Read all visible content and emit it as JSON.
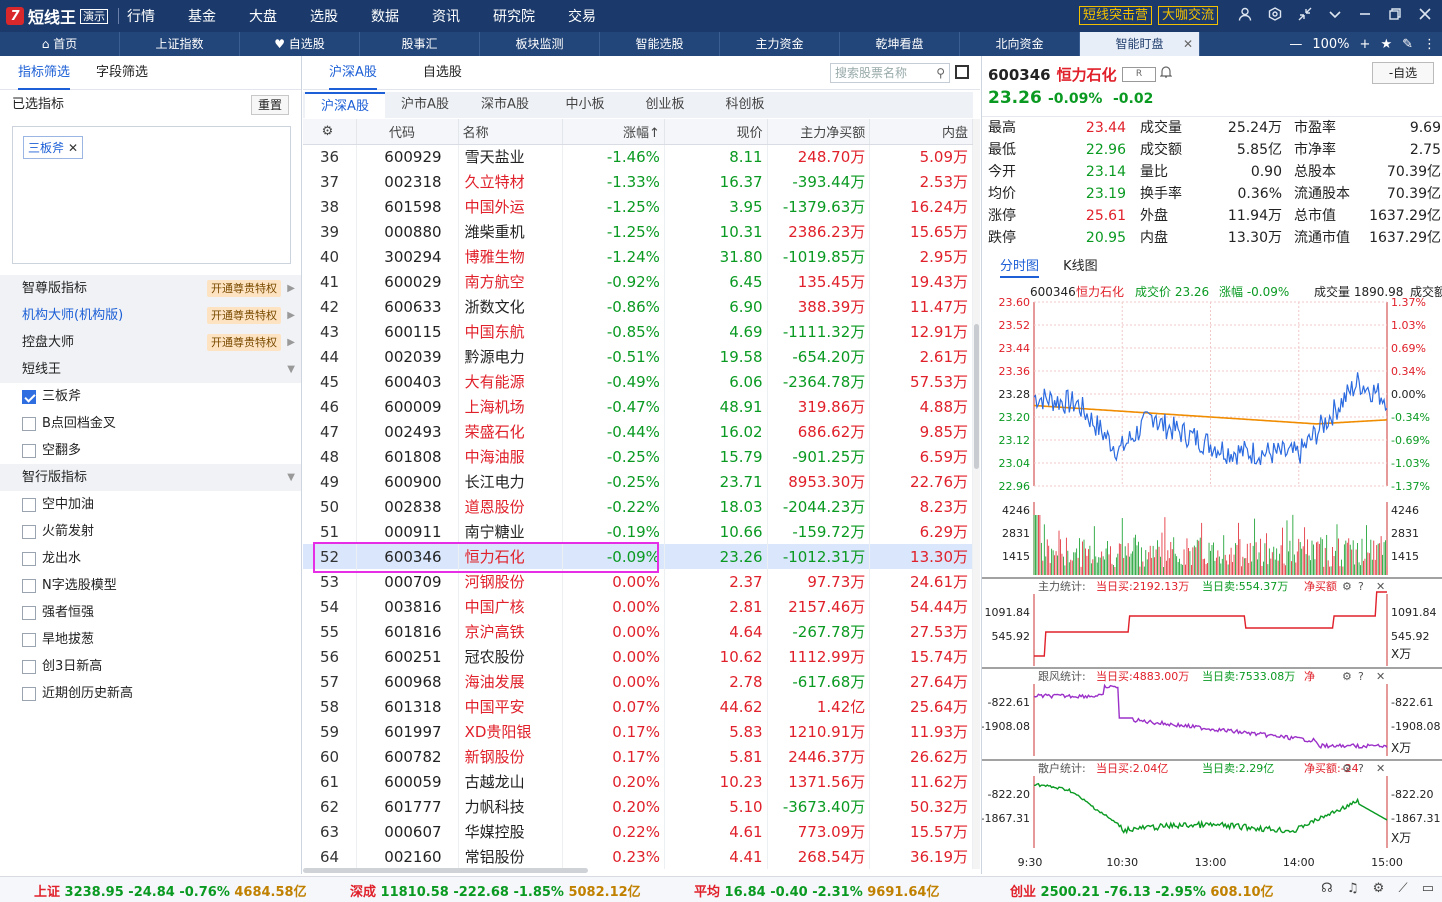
{
  "app": {
    "logo_mark": "7",
    "name": "短线王",
    "demo": "演示"
  },
  "top_menu": [
    "行情",
    "基金",
    "大盘",
    "选股",
    "数据",
    "资讯",
    "研究院",
    "交易"
  ],
  "top_buttons": [
    "短线突击营",
    "大咖交流"
  ],
  "nav_tabs": [
    {
      "label": "⌂ 首页"
    },
    {
      "label": "上证指数"
    },
    {
      "label": "♥ 自选股"
    },
    {
      "label": "股事汇"
    },
    {
      "label": "板块监测"
    },
    {
      "label": "智能选股"
    },
    {
      "label": "主力资金"
    },
    {
      "label": "乾坤看盘"
    },
    {
      "label": "北向资金"
    },
    {
      "label": "智能盯盘"
    }
  ],
  "zoom": "100%",
  "left": {
    "tabs": [
      "指标筛选",
      "字段筛选"
    ],
    "selected_title": "已选指标",
    "reset": "重置",
    "chip": "三板斧",
    "groups": [
      {
        "label": "智尊版指标",
        "badge": "开通尊贵特权"
      },
      {
        "label": "机构大师(机构版)",
        "badge": "开通尊贵特权"
      },
      {
        "label": "控盘大师",
        "badge": "开通尊贵特权"
      },
      {
        "label": "短线王"
      },
      {
        "label": "智行版指标"
      }
    ],
    "short_items": [
      "三板斧",
      "B点回档金叉",
      "空翻多"
    ],
    "smart_items": [
      "空中加油",
      "火箭发射",
      "龙出水",
      "N字选股模型",
      "强者恒强",
      "旱地拔葱",
      "创3日新高",
      "近期创历史新高"
    ]
  },
  "mid": {
    "tabs": [
      "沪深A股",
      "自选股"
    ],
    "search_placeholder": "搜索股票名称",
    "subtabs": [
      "沪深A股",
      "沪市A股",
      "深市A股",
      "中小板",
      "创业板",
      "科创板"
    ],
    "columns": [
      "代码",
      "名称",
      "涨幅↑",
      "现价",
      "主力净买额",
      "内盘"
    ],
    "rows": [
      [
        "36",
        "600929",
        "雪天盐业",
        "-1.46%",
        "8.11",
        "248.70万",
        "5.09万"
      ],
      [
        "37",
        "002318",
        "久立特材",
        "-1.33%",
        "16.37",
        "-393.44万",
        "2.53万"
      ],
      [
        "38",
        "601598",
        "中国外运",
        "-1.25%",
        "3.95",
        "-1379.63万",
        "16.24万"
      ],
      [
        "39",
        "000880",
        "潍柴重机",
        "-1.25%",
        "10.31",
        "2386.23万",
        "15.65万"
      ],
      [
        "40",
        "300294",
        "博雅生物",
        "-1.24%",
        "31.80",
        "-1019.85万",
        "2.95万"
      ],
      [
        "41",
        "600029",
        "南方航空",
        "-0.92%",
        "6.45",
        "135.45万",
        "19.43万"
      ],
      [
        "42",
        "600633",
        "浙数文化",
        "-0.86%",
        "6.90",
        "388.39万",
        "11.47万"
      ],
      [
        "43",
        "600115",
        "中国东航",
        "-0.85%",
        "4.69",
        "-1111.32万",
        "12.91万"
      ],
      [
        "44",
        "002039",
        "黔源电力",
        "-0.51%",
        "19.58",
        "-654.20万",
        "2.61万"
      ],
      [
        "45",
        "600403",
        "大有能源",
        "-0.49%",
        "6.06",
        "-2364.78万",
        "57.53万"
      ],
      [
        "46",
        "600009",
        "上海机场",
        "-0.47%",
        "48.91",
        "319.86万",
        "4.88万"
      ],
      [
        "47",
        "002493",
        "荣盛石化",
        "-0.44%",
        "16.02",
        "686.62万",
        "9.85万"
      ],
      [
        "48",
        "601808",
        "中海油服",
        "-0.25%",
        "15.79",
        "-901.25万",
        "6.59万"
      ],
      [
        "49",
        "600900",
        "长江电力",
        "-0.25%",
        "23.71",
        "8953.30万",
        "22.76万"
      ],
      [
        "50",
        "002838",
        "道恩股份",
        "-0.22%",
        "18.03",
        "-2044.23万",
        "8.23万"
      ],
      [
        "51",
        "000911",
        "南宁糖业",
        "-0.19%",
        "10.66",
        "-159.72万",
        "6.29万"
      ],
      [
        "52",
        "600346",
        "恒力石化",
        "-0.09%",
        "23.26",
        "-1012.31万",
        "13.30万"
      ],
      [
        "53",
        "000709",
        "河钢股份",
        "0.00%",
        "2.37",
        "97.73万",
        "24.61万"
      ],
      [
        "54",
        "003816",
        "中国广核",
        "0.00%",
        "2.81",
        "2157.46万",
        "54.44万"
      ],
      [
        "55",
        "601816",
        "京沪高铁",
        "0.00%",
        "4.64",
        "-267.78万",
        "27.53万"
      ],
      [
        "56",
        "600251",
        "冠农股份",
        "0.00%",
        "10.62",
        "1112.99万",
        "15.74万"
      ],
      [
        "57",
        "600968",
        "海油发展",
        "0.00%",
        "2.78",
        "-617.68万",
        "27.64万"
      ],
      [
        "58",
        "601318",
        "中国平安",
        "0.07%",
        "44.62",
        "1.42亿",
        "25.64万"
      ],
      [
        "59",
        "601997",
        "XD贵阳银",
        "0.17%",
        "5.83",
        "1210.91万",
        "11.93万"
      ],
      [
        "60",
        "600782",
        "新钢股份",
        "0.17%",
        "5.81",
        "2446.37万",
        "26.62万"
      ],
      [
        "61",
        "600059",
        "古越龙山",
        "0.20%",
        "10.23",
        "1371.56万",
        "11.62万"
      ],
      [
        "62",
        "601777",
        "力帆科技",
        "0.20%",
        "5.10",
        "-3673.40万",
        "50.32万"
      ],
      [
        "63",
        "000607",
        "华媒控股",
        "0.22%",
        "4.61",
        "773.09万",
        "15.57万"
      ],
      [
        "64",
        "002160",
        "常铝股份",
        "0.23%",
        "4.41",
        "268.54万",
        "36.19万"
      ]
    ],
    "red_names": [
      "久立特材",
      "中国外运",
      "博雅生物",
      "南方航空",
      "中国东航",
      "大有能源",
      "上海机场",
      "荣盛石化",
      "中海油服",
      "道恩股份",
      "恒力石化",
      "河钢股份",
      "中国广核",
      "京沪高铁",
      "海油发展",
      "中国平安",
      "XD贵阳银",
      "新钢股份"
    ],
    "selected_row": "52"
  },
  "quote": {
    "code": "600346",
    "name": "恒力石化",
    "tag": "R",
    "zx": "-自选",
    "price": "23.26",
    "chg_pct": "-0.09%",
    "chg": "-0.02",
    "rows": [
      [
        "最高",
        "23.44",
        "成交量",
        "25.24万",
        "市盈率",
        "9.69"
      ],
      [
        "最低",
        "22.96",
        "成交额",
        "5.85亿",
        "市净率",
        "2.75"
      ],
      [
        "今开",
        "23.14",
        "量比",
        "0.90",
        "总股本",
        "70.39亿"
      ],
      [
        "均价",
        "23.19",
        "换手率",
        "0.36%",
        "流通股本",
        "70.39亿"
      ],
      [
        "涨停",
        "25.61",
        "外盘",
        "11.94万",
        "总市值",
        "1637.29亿"
      ],
      [
        "跌停",
        "20.95",
        "内盘",
        "13.30万",
        "流通市值",
        "1637.29亿"
      ]
    ],
    "value_colors": [
      "r",
      "g",
      "g",
      "g",
      "r",
      "g"
    ],
    "chart_tabs": [
      "分时图",
      "K线图"
    ],
    "chart_header": {
      "code": "600346",
      "name": "恒力石化",
      "price_label": "成交价 23.26",
      "chg_label": "涨幅 -0.09%",
      "vol_label": "成交量 1890.98",
      "vol_label2": "成交额"
    },
    "price_ticks": [
      "23.60",
      "23.52",
      "23.44",
      "23.36",
      "23.28",
      "23.20",
      "23.12",
      "23.04",
      "22.96"
    ],
    "pct_ticks": [
      "1.37%",
      "1.03%",
      "0.69%",
      "0.34%",
      "0.00%",
      "-0.34%",
      "-0.69%",
      "-1.03%",
      "-1.37%"
    ],
    "vol_ticks": [
      "4246",
      "2831",
      "1415"
    ],
    "panels": [
      {
        "title": "主力统计:",
        "buy": "当日买:2192.13万",
        "sell": "当日卖:554.37万",
        "net": "净买额",
        "ticks": [
          "1091.84",
          "545.92"
        ],
        "unit": "X万"
      },
      {
        "title": "跟风统计:",
        "buy": "当日买:4883.00万",
        "sell": "当日卖:7533.08万",
        "net": "净",
        "ticks": [
          "-822.61",
          "-1908.08"
        ],
        "unit": "X万"
      },
      {
        "title": "散户统计:",
        "buy": "当日买:2.04亿",
        "sell": "当日卖:2.29亿",
        "net": "净买额:-24",
        "ticks": [
          "-822.20",
          "-1867.31"
        ],
        "unit": "X万"
      }
    ],
    "time_ticks": [
      "9:30",
      "10:30",
      "13:00",
      "14:00",
      "15:00"
    ]
  },
  "status": [
    {
      "name": "上证",
      "val": "3238.95",
      "chg": "-24.84",
      "pct": "-0.76%",
      "amt": "4684.58亿"
    },
    {
      "name": "深成",
      "val": "11810.58",
      "chg": "-222.68",
      "pct": "-1.85%",
      "amt": "5082.12亿"
    },
    {
      "name": "平均",
      "val": "16.84",
      "chg": "-0.40",
      "pct": "-2.31%",
      "amt": "9691.64亿"
    },
    {
      "name": "创业",
      "val": "2500.21",
      "chg": "-76.13",
      "pct": "-2.95%",
      "amt": "608.10亿"
    }
  ],
  "colors": {
    "up": "#e0202a",
    "down": "#0a9a22",
    "accent": "#1c5fd6",
    "topbar": "#1b3a6b",
    "highlight": "#e62ee6",
    "price_line": "#2c6be0",
    "avg_line": "#f08c00"
  }
}
